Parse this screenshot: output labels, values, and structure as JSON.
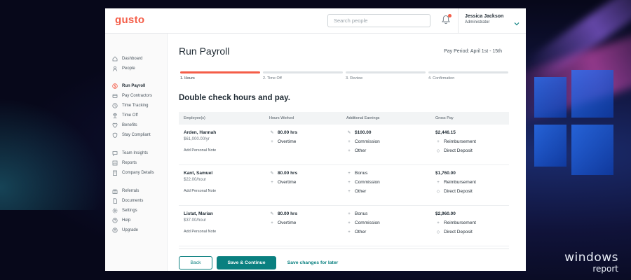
{
  "brand": {
    "logo_text": "gusto",
    "accent": "#f45d48",
    "primary": "#0a8080"
  },
  "header": {
    "search_placeholder": "Search people",
    "user_name": "Jessica Jackson",
    "user_role": "Administrator"
  },
  "sidebar": {
    "items": [
      {
        "label": "Dashboard",
        "icon": "home-icon"
      },
      {
        "label": "People",
        "icon": "person-icon"
      },
      {
        "label": "Run Payroll",
        "icon": "dollar-icon"
      },
      {
        "label": "Pay Contractors",
        "icon": "wallet-icon"
      },
      {
        "label": "Time Tracking",
        "icon": "clock-icon"
      },
      {
        "label": "Time Off",
        "icon": "beach-icon"
      },
      {
        "label": "Benefits",
        "icon": "heart-icon"
      },
      {
        "label": "Stay Compliant",
        "icon": "shield-icon"
      },
      {
        "label": "Team Insights",
        "icon": "chat-icon"
      },
      {
        "label": "Reports",
        "icon": "chart-icon"
      },
      {
        "label": "Company Details",
        "icon": "building-icon"
      },
      {
        "label": "Referrals",
        "icon": "gift-icon"
      },
      {
        "label": "Documents",
        "icon": "document-icon"
      },
      {
        "label": "Settings",
        "icon": "gear-icon"
      },
      {
        "label": "Help",
        "icon": "help-icon"
      },
      {
        "label": "Upgrade",
        "icon": "upgrade-icon"
      }
    ]
  },
  "page": {
    "title": "Run Payroll",
    "pay_period": "Pay Period: April 1st - 15th",
    "steps": [
      "1. Hours",
      "2. Time Off",
      "3. Review",
      "4. Confirmation"
    ],
    "current_step": 1,
    "subtitle": "Double check hours and pay."
  },
  "table": {
    "headers": [
      "Employee(s)",
      "Hours Worked",
      "Additional Earnings",
      "Gross Pay"
    ],
    "rows": [
      {
        "name": "Arden, Hannah",
        "rate": "$61,000.00/yr",
        "note": "Add Personal Note",
        "hours": "80.00 hrs",
        "overtime": "Overtime",
        "earnings": [
          "$100.00",
          "Commission",
          "Other"
        ],
        "gross": "$2,446.15",
        "reimbursement": "Reimbursement",
        "deposit": "Direct Deposit"
      },
      {
        "name": "Kant, Samuel",
        "rate": "$22.00/hour",
        "note": "Add Personal Note",
        "hours": "80.00 hrs",
        "overtime": "Overtime",
        "earnings": [
          "Bonus",
          "Commission",
          "Other"
        ],
        "gross": "$1,760.00",
        "reimbursement": "Reimbursement",
        "deposit": "Direct Deposit"
      },
      {
        "name": "Listat, Marian",
        "rate": "$37.00/hour",
        "note": "Add Personal Note",
        "hours": "80.00 hrs",
        "overtime": "Overtime",
        "earnings": [
          "Bonus",
          "Commission",
          "Other"
        ],
        "gross": "$2,960.00",
        "reimbursement": "Reimbursement",
        "deposit": "Direct Deposit"
      }
    ]
  },
  "footer": {
    "back_label": "Back",
    "save_continue_label": "Save & Continue",
    "save_later_label": "Save changes for later"
  },
  "watermark": {
    "line1": "windows",
    "line2": "report"
  }
}
